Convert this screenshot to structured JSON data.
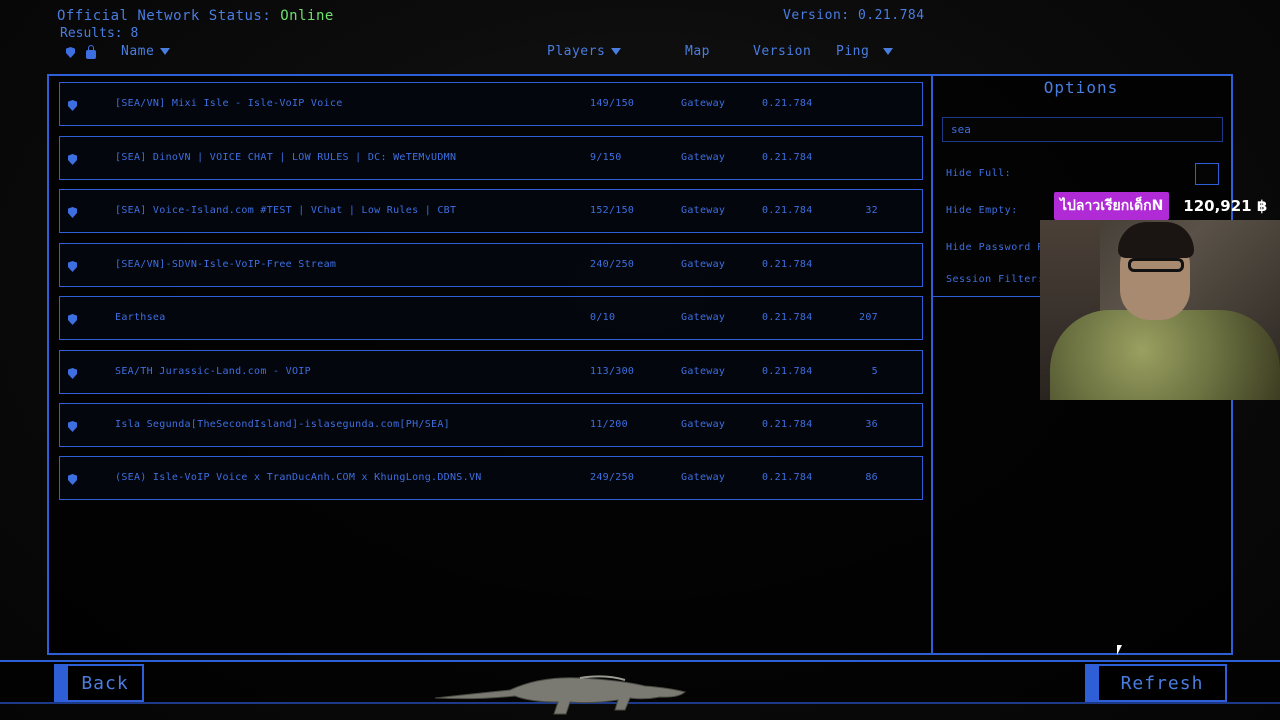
{
  "status": {
    "label": "Official Network Status:",
    "value": "Online",
    "results_label": "Results:",
    "results_count": "8"
  },
  "version": {
    "label": "Version:",
    "value": "0.21.784"
  },
  "headers": {
    "name": "Name",
    "players": "Players",
    "map": "Map",
    "version": "Version",
    "ping": "Ping"
  },
  "servers": [
    {
      "name": "[SEA/VN] Mixi Isle - Isle-VoIP Voice",
      "players": "149/150",
      "map": "Gateway",
      "version": "0.21.784",
      "ping": ""
    },
    {
      "name": "[SEA] DinoVN | VOICE CHAT | LOW RULES | DC: WeTEMvUDMN",
      "players": "9/150",
      "map": "Gateway",
      "version": "0.21.784",
      "ping": ""
    },
    {
      "name": "[SEA] Voice-Island.com #TEST | VChat | Low Rules | CBT",
      "players": "152/150",
      "map": "Gateway",
      "version": "0.21.784",
      "ping": "32"
    },
    {
      "name": "[SEA/VN]-SDVN-Isle-VoIP-Free Stream",
      "players": "240/250",
      "map": "Gateway",
      "version": "0.21.784",
      "ping": ""
    },
    {
      "name": "Earthsea",
      "players": "0/10",
      "map": "Gateway",
      "version": "0.21.784",
      "ping": "207"
    },
    {
      "name": "SEA/TH Jurassic-Land.com - VOIP",
      "players": "113/300",
      "map": "Gateway",
      "version": "0.21.784",
      "ping": "5"
    },
    {
      "name": "Isla Segunda[TheSecondIsland]-islasegunda.com[PH/SEA]",
      "players": "11/200",
      "map": "Gateway",
      "version": "0.21.784",
      "ping": "36"
    },
    {
      "name": "(SEA) Isle-VoIP Voice x TranDucAnh.COM x KhungLong.DDNS.VN",
      "players": "249/250",
      "map": "Gateway",
      "version": "0.21.784",
      "ping": "86"
    }
  ],
  "options": {
    "title": "Options",
    "search_value": "sea",
    "hide_full": "Hide Full:",
    "hide_empty": "Hide Empty:",
    "hide_password": "Hide Password P",
    "session_filter": "Session Filter:"
  },
  "donation": {
    "name": "ไปลาวเรียกเด็กN",
    "amount": "120,921 ฿"
  },
  "buttons": {
    "back": "Back",
    "refresh": "Refresh"
  },
  "colors": {
    "accent": "#2e5fd6",
    "text": "#4a7de0",
    "online": "#6ee06e",
    "donation": "#b02ad6"
  }
}
